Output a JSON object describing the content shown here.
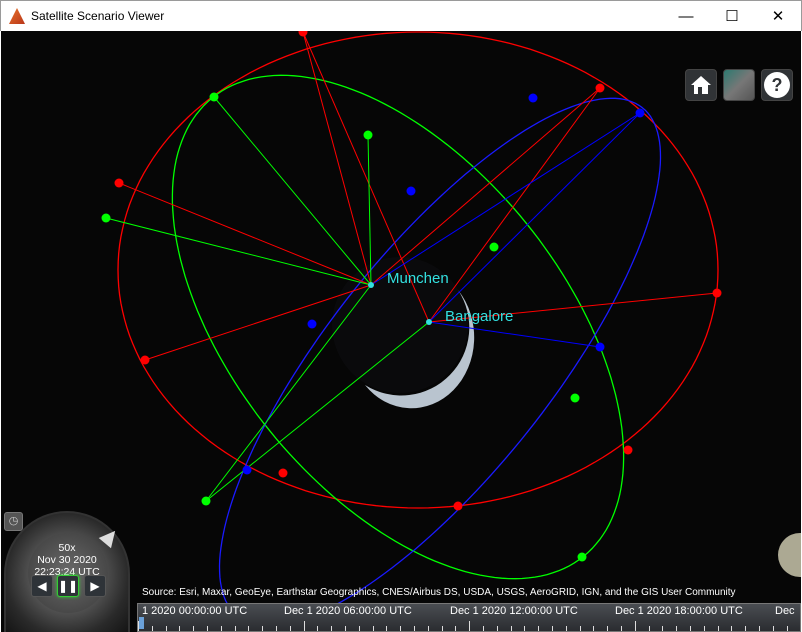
{
  "window": {
    "title": "Satellite Scenario Viewer",
    "minimize": "—",
    "maximize": "☐",
    "close": "✕"
  },
  "toolbar": {
    "home_icon": "home-icon",
    "imagery_icon": "base-layer-picker-icon",
    "help_icon": "?"
  },
  "ground_stations": [
    {
      "name": "Munchen"
    },
    {
      "name": "Bangalore"
    }
  ],
  "colors": {
    "orbit1": "#ff0000",
    "orbit2": "#00ff00",
    "orbit3": "#0000ff",
    "label": "#33e0e0"
  },
  "attribution": "Source: Esri, Maxar, GeoEye, Earthstar Geographics, CNES/Airbus DS, USDA, USGS, AeroGRID, IGN, and the GIS User Community",
  "animation": {
    "speed": "50x",
    "date": "Nov 30 2020",
    "time": "22:23:24 UTC",
    "rewind": "◀",
    "pause": "❚❚",
    "play": "▶"
  },
  "timeline": {
    "labels": [
      "1 2020 00:00:00 UTC",
      "Dec 1 2020 06:00:00 UTC",
      "Dec 1 2020 12:00:00 UTC",
      "Dec 1 2020 18:00:00 UTC",
      "Dec"
    ]
  }
}
